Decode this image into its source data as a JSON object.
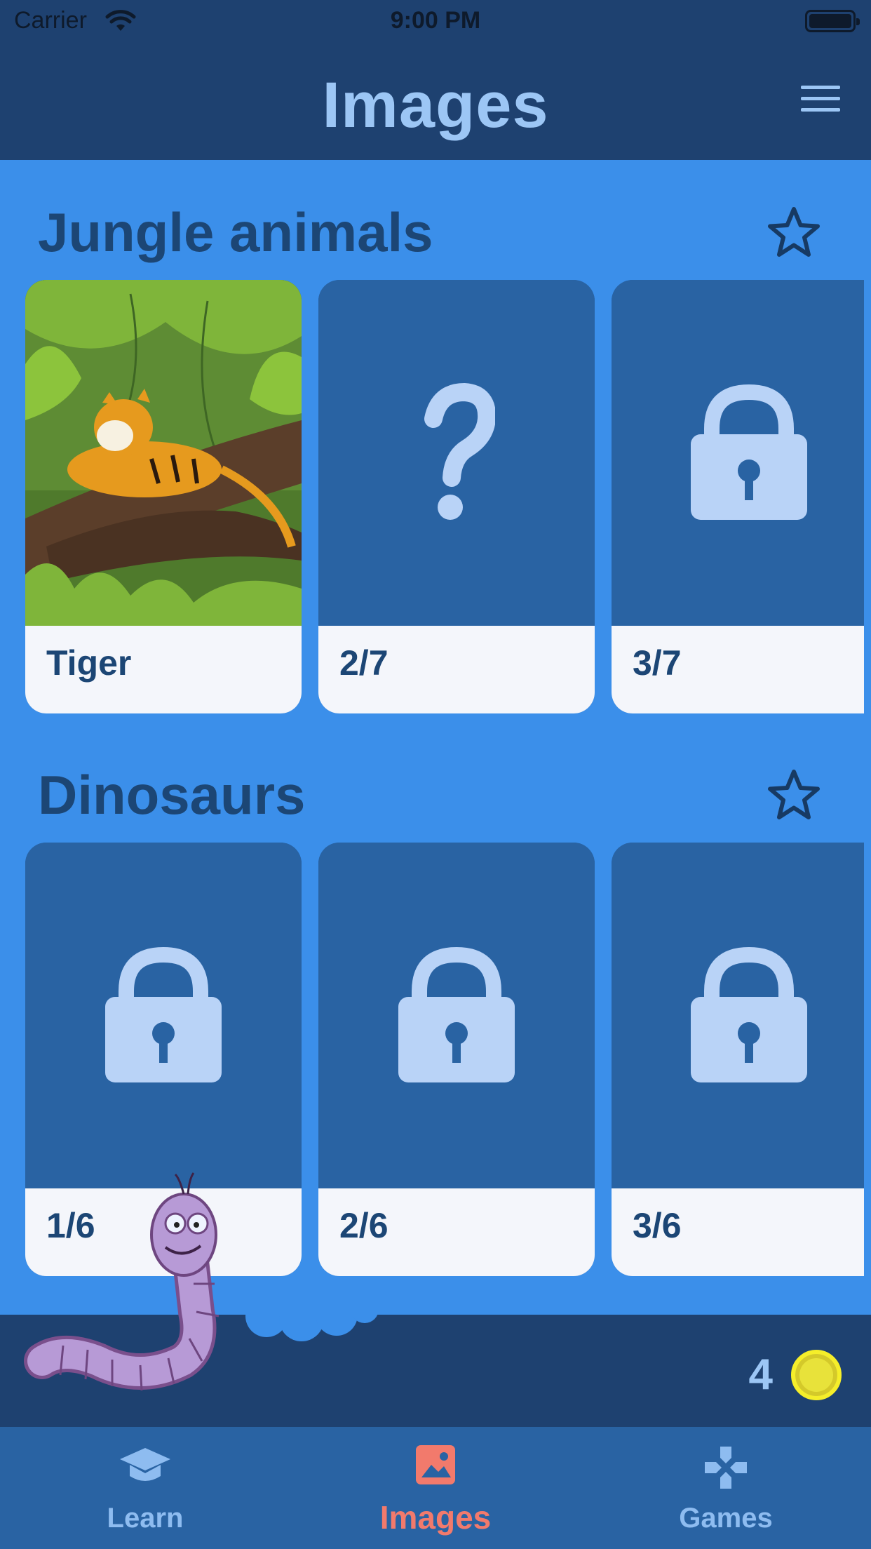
{
  "status_bar": {
    "carrier": "Carrier",
    "time": "9:00 PM"
  },
  "header": {
    "title": "Images",
    "menu_icon": "hamburger-menu-icon"
  },
  "sections": [
    {
      "title": "Jungle animals",
      "favorite_icon": "star-outline-icon",
      "cards": [
        {
          "label": "Tiger",
          "state": "unlocked",
          "image": "tiger-in-jungle"
        },
        {
          "label": "2/7",
          "state": "unknown",
          "icon": "question-mark-icon"
        },
        {
          "label": "3/7",
          "state": "locked",
          "icon": "lock-icon"
        }
      ]
    },
    {
      "title": "Dinosaurs",
      "favorite_icon": "star-outline-icon",
      "cards": [
        {
          "label": "1/6",
          "state": "locked",
          "icon": "lock-icon"
        },
        {
          "label": "2/6",
          "state": "locked",
          "icon": "lock-icon"
        },
        {
          "label": "3/6",
          "state": "locked",
          "icon": "lock-icon"
        }
      ]
    }
  ],
  "coins": {
    "count": "4",
    "icon": "gold-coin-icon"
  },
  "tabs": [
    {
      "label": "Learn",
      "icon": "graduation-cap-icon",
      "active": false
    },
    {
      "label": "Images",
      "icon": "picture-icon",
      "active": true
    },
    {
      "label": "Games",
      "icon": "gamepad-icon",
      "active": false
    }
  ],
  "colors": {
    "header_bg": "#1e4170",
    "page_bg": "#3b8fea",
    "card_bg": "#2963a3",
    "icon_light": "#b9d3f7",
    "active_tab": "#f27a6c",
    "coin": "#e8e23a"
  }
}
